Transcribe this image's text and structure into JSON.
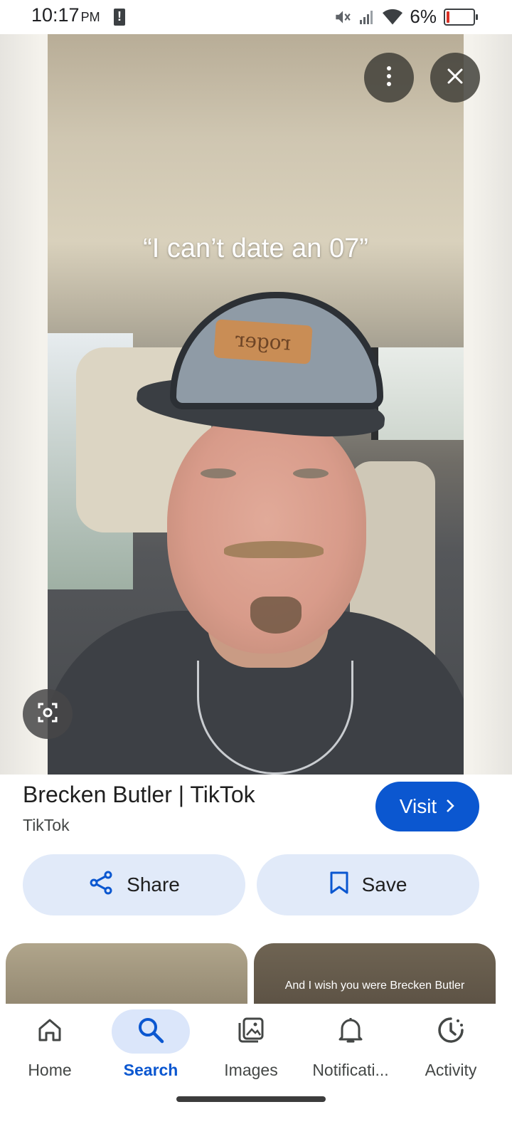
{
  "status_bar": {
    "time": "10:17",
    "ampm": "PM",
    "battery": "6%",
    "icons": [
      "alert-icon",
      "mute-icon",
      "signal-icon",
      "wifi-icon",
      "battery-icon"
    ]
  },
  "viewer": {
    "caption": "“I can’t date an 07”",
    "cap_patch": "roger",
    "buttons": [
      "more-options-icon",
      "close-icon",
      "lens-icon"
    ]
  },
  "result": {
    "title": "Brecken Butler | TikTok",
    "source": "TikTok",
    "visit_label": "Visit",
    "share_label": "Share",
    "save_label": "Save"
  },
  "related": {
    "second_caption": "And I wish you were Brecken Butler"
  },
  "bottom_nav": {
    "items": [
      {
        "label": "Home",
        "icon": "home-icon"
      },
      {
        "label": "Search",
        "icon": "search-icon",
        "active": true
      },
      {
        "label": "Images",
        "icon": "images-icon"
      },
      {
        "label": "Notificati...",
        "icon": "bell-icon"
      },
      {
        "label": "Activity",
        "icon": "activity-icon"
      }
    ]
  },
  "colors": {
    "accent": "#0b57d0",
    "pill_bg": "#e1eaf9",
    "nav_active_bg": "#dbe6fa",
    "battery_low": "#d93025"
  }
}
